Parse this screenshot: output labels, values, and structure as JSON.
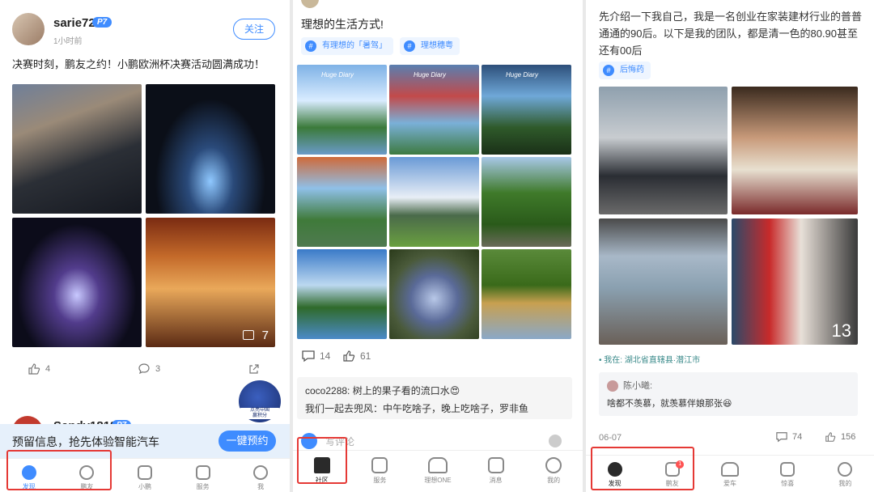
{
  "panel1": {
    "post": {
      "username": "sarie72",
      "badge": "P7",
      "time": "1小时前",
      "follow_label": "关注",
      "content": "决赛时刻，鹏友之约！小鹏欧洲杯决赛活动圆满成功！",
      "more_images": "7",
      "likes": "4",
      "comments": "3"
    },
    "next_user": "Sandy1818",
    "next_badge": "P7",
    "floating_label": "点亮中国\n赢积分",
    "banner_text": "预留信息，抢先体验智能汽车",
    "banner_cta": "一键预约",
    "tabs": [
      "发现",
      "鹏友",
      "小鹏",
      "服务",
      "我"
    ]
  },
  "panel2": {
    "title": "理想的生活方式!",
    "tags": [
      "有理想的「暑驾」",
      "理想穗粤"
    ],
    "watermark": "Huge Diary",
    "comments_count": "14",
    "likes": "61",
    "comment_lines": [
      {
        "user": "coco2288:",
        "text": "树上的果子看的流口水😍"
      },
      {
        "user": "",
        "text": "我们一起去兜风：中午吃啥子，晚上吃啥子，罗非鱼"
      }
    ],
    "comment_placeholder": "写评论",
    "tabs": [
      "社区",
      "服务",
      "理想ONE",
      "消息",
      "我的"
    ]
  },
  "panel3": {
    "intro": "先介绍一下我自己，我是一名创业在家装建材行业的普普通通的90后。以下是我的团队，都是清一色的80.90甚至还有00后",
    "tag": "后悔药",
    "more_images": "13",
    "location": "我在: 湖北省直辖县·潜江市",
    "commenter": "陈小曦:",
    "comment": "啥都不羡慕，就羡慕伴娘那张😆",
    "date": "06-07",
    "comments_count": "74",
    "likes": "156",
    "tabs": [
      "发现",
      "鹏友",
      "爱车",
      "惊喜",
      "我的"
    ],
    "notif": "1"
  },
  "colors": {
    "accent": "#3f8cff",
    "highlight": "#e53935"
  }
}
